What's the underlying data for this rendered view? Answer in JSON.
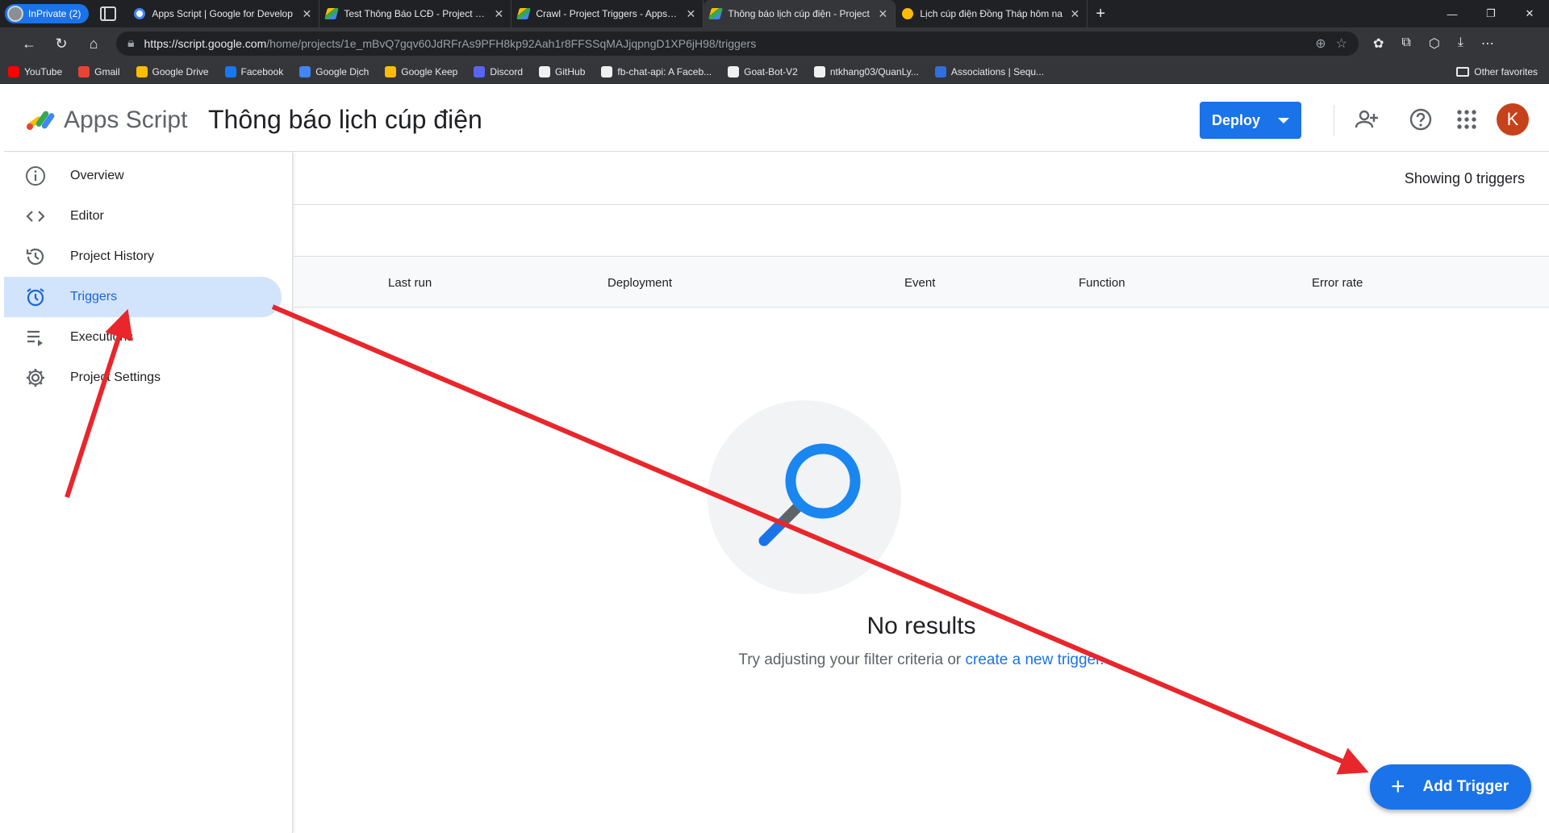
{
  "browser": {
    "inprivate_label": "InPrivate (2)",
    "tabs": [
      {
        "title": "Apps Script  |  Google for Develop",
        "icon": "google-icon"
      },
      {
        "title": "Test Thông Báo LCĐ - Project Edit",
        "icon": "apps-script-icon"
      },
      {
        "title": "Crawl - Project Triggers - Apps Sc",
        "icon": "apps-script-icon"
      },
      {
        "title": "Thông báo lịch cúp điện - Project",
        "icon": "apps-script-icon"
      },
      {
        "title": "Lịch cúp điện Đồng Tháp hôm na",
        "icon": "bulb-icon"
      }
    ],
    "url_host": "https://script.google.com",
    "url_path": "/home/projects/1e_mBvQ7gqv60JdRFrAs9PFH8kp92Aah1r8FFSSqMAJjqpngD1XP6jH98/triggers",
    "bookmarks": [
      {
        "label": "YouTube",
        "color": "#ff0000"
      },
      {
        "label": "Gmail",
        "color": "#ea4335"
      },
      {
        "label": "Google Drive",
        "color": "#fbbc04"
      },
      {
        "label": "Facebook",
        "color": "#1877f2"
      },
      {
        "label": "Google Dịch",
        "color": "#4285f4"
      },
      {
        "label": "Google Keep",
        "color": "#fbbc04"
      },
      {
        "label": "Discord",
        "color": "#5865f2"
      },
      {
        "label": "GitHub",
        "color": "#f0f0f0"
      },
      {
        "label": "fb-chat-api: A Faceb...",
        "color": "#f0f0f0"
      },
      {
        "label": "Goat-Bot-V2",
        "color": "#f0f0f0"
      },
      {
        "label": "ntkhang03/QuanLy...",
        "color": "#f0f0f0"
      },
      {
        "label": "Associations | Sequ...",
        "color": "#2f6fe0"
      }
    ],
    "other_favorites": "Other favorites"
  },
  "app": {
    "brand": "Apps Script",
    "project_title": "Thông báo lịch cúp điện",
    "deploy_label": "Deploy",
    "avatar_letter": "K",
    "avatar_color": "#c5421b"
  },
  "sidebar": {
    "items": [
      {
        "label": "Overview",
        "icon": "info-icon"
      },
      {
        "label": "Editor",
        "icon": "code-icon"
      },
      {
        "label": "Project History",
        "icon": "history-icon"
      },
      {
        "label": "Triggers",
        "icon": "alarm-icon",
        "active": true
      },
      {
        "label": "Executions",
        "icon": "executions-icon"
      },
      {
        "label": "Project Settings",
        "icon": "gear-icon"
      }
    ]
  },
  "main": {
    "showing": "Showing 0 triggers",
    "columns": [
      "Last run",
      "Deployment",
      "Event",
      "Function",
      "Error rate"
    ],
    "empty_title": "No results",
    "empty_hint_prefix": "Try adjusting your filter criteria or ",
    "empty_hint_link": "create a new trigger.",
    "fab_label": "Add Trigger"
  },
  "annotation_color": "#e8262b"
}
